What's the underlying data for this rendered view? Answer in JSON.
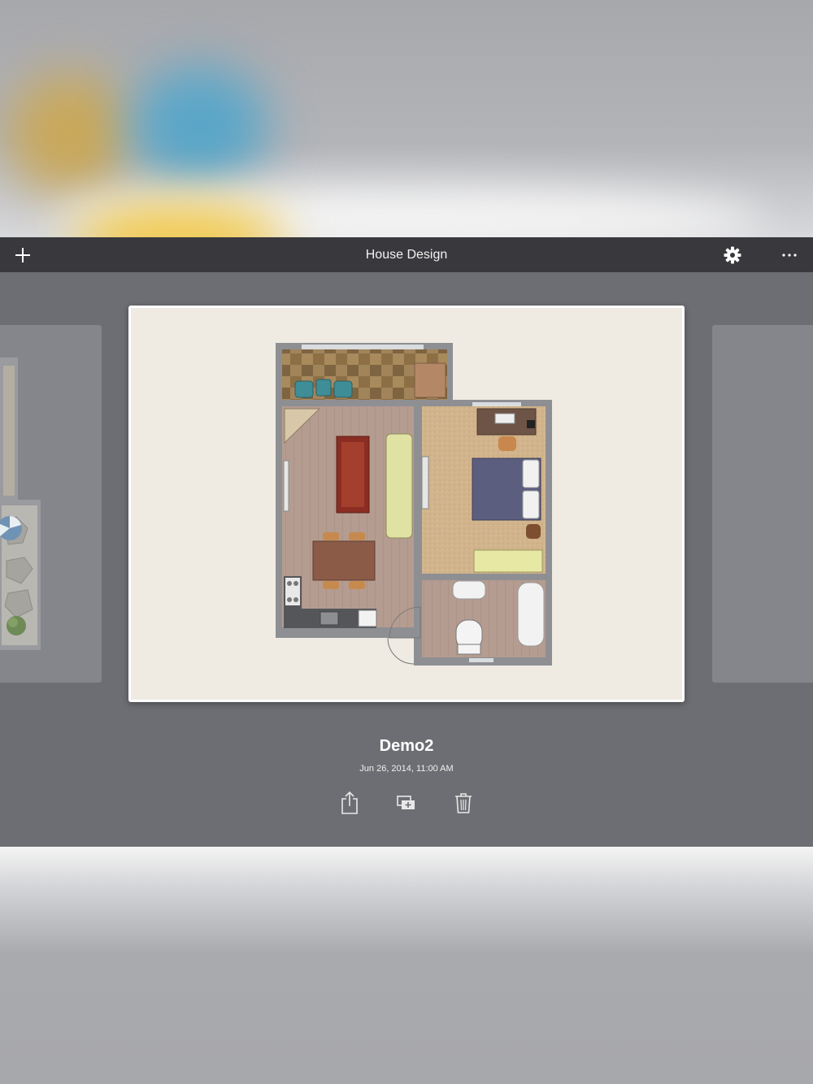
{
  "navbar": {
    "title": "House Design",
    "add_icon": "plus-icon",
    "settings_icon": "gear-icon",
    "more_icon": "ellipsis-icon"
  },
  "document": {
    "name": "Demo2",
    "date": "Jun 26, 2014, 11:00 AM"
  },
  "actions": {
    "share_icon": "share-icon",
    "duplicate_icon": "duplicate-icon",
    "delete_icon": "trash-icon"
  },
  "colors": {
    "navbar": "#39393d",
    "content_bg": "#6d6e73",
    "paper": "#efebe2"
  }
}
